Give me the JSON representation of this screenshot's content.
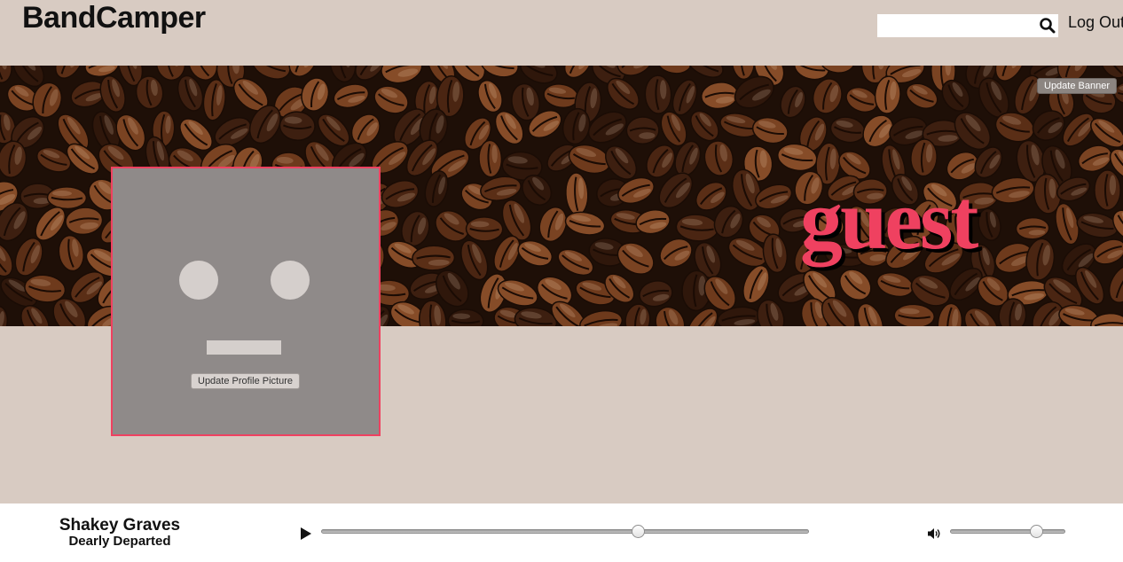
{
  "app": {
    "name": "BandCamper"
  },
  "header": {
    "search": {
      "value": "",
      "placeholder": ""
    },
    "logout_label": "Log Out"
  },
  "banner": {
    "update_label": "Update Banner",
    "username": "guest"
  },
  "profile": {
    "update_label": "Update Profile Picture"
  },
  "player": {
    "artist": "Shakey Graves",
    "track": "Dearly Departed",
    "progress": 0.65,
    "volume": 0.75
  },
  "colors": {
    "background": "#d8cbc2",
    "accent": "#ef4160",
    "avatar_bg": "#8f8a89"
  },
  "icons": [
    "search-icon",
    "play-icon",
    "volume-icon"
  ]
}
